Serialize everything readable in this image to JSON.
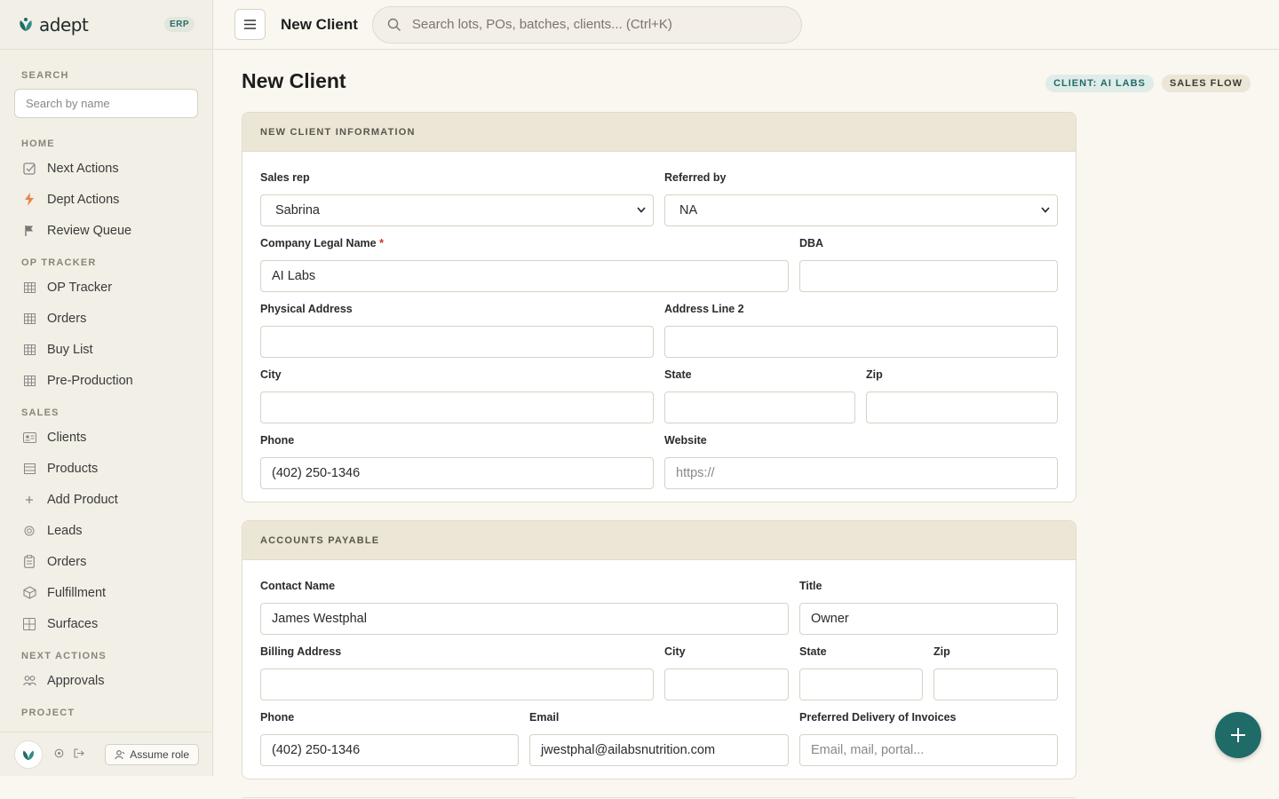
{
  "brand": {
    "name": "adept",
    "badge": "ERP"
  },
  "sidebar": {
    "search": {
      "heading": "SEARCH",
      "placeholder": "Search by name"
    },
    "sections": [
      {
        "heading": "HOME",
        "items": [
          {
            "label": "Next Actions",
            "icon": "check-square-icon"
          },
          {
            "label": "Dept Actions",
            "icon": "bolt-icon"
          },
          {
            "label": "Review Queue",
            "icon": "flag-icon"
          }
        ]
      },
      {
        "heading": "OP TRACKER",
        "items": [
          {
            "label": "OP Tracker",
            "icon": "grid-icon"
          },
          {
            "label": "Orders",
            "icon": "grid-icon"
          },
          {
            "label": "Buy List",
            "icon": "grid-icon"
          },
          {
            "label": "Pre-Production",
            "icon": "grid-icon"
          }
        ]
      },
      {
        "heading": "SALES",
        "items": [
          {
            "label": "Clients",
            "icon": "id-card-icon"
          },
          {
            "label": "Products",
            "icon": "list-icon"
          },
          {
            "label": "Add Product",
            "icon": "plus-icon"
          },
          {
            "label": "Leads",
            "icon": "target-icon"
          },
          {
            "label": "Orders",
            "icon": "clipboard-icon"
          },
          {
            "label": "Fulfillment",
            "icon": "box-icon"
          },
          {
            "label": "Surfaces",
            "icon": "layout-icon"
          }
        ]
      },
      {
        "heading": "NEXT ACTIONS",
        "items": [
          {
            "label": "Approvals",
            "icon": "users-icon"
          }
        ]
      },
      {
        "heading": "PROJECT",
        "items": []
      }
    ],
    "footer": {
      "assume_role": "Assume role"
    }
  },
  "topbar": {
    "title": "New Client",
    "search_placeholder": "Search lots, POs, batches, clients...  (Ctrl+K)"
  },
  "page": {
    "title": "New Client",
    "badges": [
      "CLIENT: AI LABS",
      "SALES FLOW"
    ]
  },
  "client_info": {
    "heading": "NEW CLIENT INFORMATION",
    "sales_rep": {
      "label": "Sales rep",
      "value": "Sabrina"
    },
    "referred_by": {
      "label": "Referred by",
      "value": "NA"
    },
    "company_legal_name": {
      "label": "Company Legal Name",
      "required": "*",
      "value": "AI Labs"
    },
    "dba": {
      "label": "DBA",
      "value": ""
    },
    "physical_address": {
      "label": "Physical Address",
      "value": ""
    },
    "address_line_2": {
      "label": "Address Line 2",
      "value": ""
    },
    "city": {
      "label": "City",
      "value": ""
    },
    "state": {
      "label": "State",
      "value": ""
    },
    "zip": {
      "label": "Zip",
      "value": ""
    },
    "phone": {
      "label": "Phone",
      "value": "(402) 250-1346"
    },
    "website": {
      "label": "Website",
      "placeholder": "https://"
    }
  },
  "accounts_payable": {
    "heading": "ACCOUNTS PAYABLE",
    "contact_name": {
      "label": "Contact Name",
      "value": "James Westphal"
    },
    "title": {
      "label": "Title",
      "value": "Owner"
    },
    "billing_address": {
      "label": "Billing Address",
      "value": ""
    },
    "city": {
      "label": "City",
      "value": ""
    },
    "state": {
      "label": "State",
      "value": ""
    },
    "zip": {
      "label": "Zip",
      "value": ""
    },
    "phone": {
      "label": "Phone",
      "value": "(402) 250-1346"
    },
    "email": {
      "label": "Email",
      "value": "jwestphal@ailabsnutrition.com"
    },
    "preferred_delivery": {
      "label": "Preferred Delivery of Invoices",
      "placeholder": "Email, mail, portal..."
    }
  },
  "colors": {
    "accent": "#1f6b68",
    "background": "#faf7f0",
    "sidebar": "#f2efe7",
    "card_header": "#ece6d6"
  }
}
